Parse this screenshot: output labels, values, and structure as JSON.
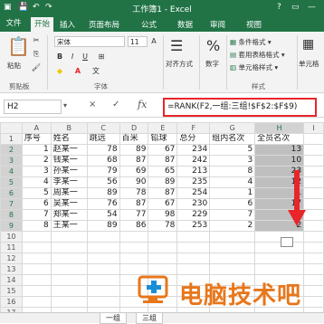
{
  "window": {
    "title": "工作簿1 - Excel",
    "help": "?"
  },
  "ribbon_tabs": [
    "文件",
    "开始",
    "插入",
    "页面布局",
    "公式",
    "数据",
    "审阅",
    "视图"
  ],
  "ribbon": {
    "paste": "粘贴",
    "clipboard_group": "剪贴板",
    "font_name": "宋体",
    "font_size": "11",
    "bold": "B",
    "italic": "I",
    "underline": "U",
    "font_group": "字体",
    "alignment": "对齐方式",
    "number": "%",
    "number_label": "数字",
    "conditional_format": "条件格式",
    "table_format": "套用表格格式",
    "cell_style": "单元格样式",
    "styles_group": "样式",
    "cells": "单元格"
  },
  "formula_bar": {
    "name_box": "H2",
    "cancel": "×",
    "enter": "✓",
    "fx": "fx",
    "formula": "=RANK(F2,一组:三组!$F$2:$F$9)"
  },
  "columns": [
    "A",
    "B",
    "C",
    "D",
    "E",
    "F",
    "G",
    "H",
    "I"
  ],
  "rows": [
    "1",
    "2",
    "3",
    "4",
    "5",
    "6",
    "7",
    "8",
    "9",
    "10",
    "11",
    "12",
    "13",
    "14",
    "15",
    "16",
    "17"
  ],
  "header_row": [
    "序号",
    "姓名",
    "跳远",
    "百米",
    "铅球",
    "总分",
    "组内名次",
    "全员名次"
  ],
  "data_rows": [
    [
      "1",
      "赵某一",
      "78",
      "89",
      "67",
      "234",
      "5",
      "13"
    ],
    [
      "2",
      "钱某一",
      "68",
      "87",
      "87",
      "242",
      "3",
      "10"
    ],
    [
      "3",
      "孙某一",
      "79",
      "69",
      "65",
      "213",
      "8",
      "23"
    ],
    [
      "4",
      "李某一",
      "56",
      "90",
      "89",
      "235",
      "4",
      "12"
    ],
    [
      "5",
      "周某一",
      "89",
      "78",
      "87",
      "254",
      "1",
      "1"
    ],
    [
      "6",
      "吴某一",
      "76",
      "87",
      "67",
      "230",
      "6",
      "17"
    ],
    [
      "7",
      "郑某一",
      "54",
      "77",
      "98",
      "229",
      "7",
      "18"
    ],
    [
      "8",
      "王某一",
      "89",
      "86",
      "78",
      "253",
      "2",
      "2"
    ]
  ],
  "sheet_tabs": [
    "一组",
    "三组"
  ],
  "watermark": "电脑技术吧",
  "colors": {
    "excel_green": "#217346",
    "highlight_red": "#e8262a",
    "watermark_orange": "#e8761a"
  }
}
